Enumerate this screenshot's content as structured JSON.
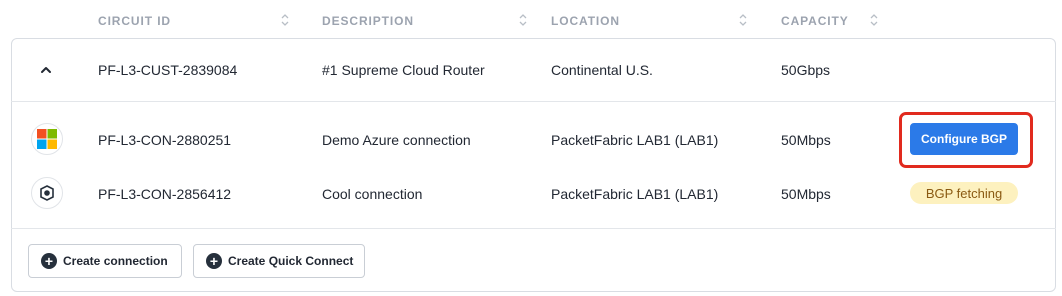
{
  "columns": {
    "circuit_id": "CIRCUIT ID",
    "description": "DESCRIPTION",
    "location": "LOCATION",
    "capacity": "CAPACITY"
  },
  "parent_row": {
    "circuit_id": "PF-L3-CUST-2839084",
    "description": "#1 Supreme Cloud Router",
    "location": "Continental U.S.",
    "capacity": "50Gbps",
    "expanded": true
  },
  "connections": [
    {
      "logo": "microsoft-icon",
      "circuit_id": "PF-L3-CON-2880251",
      "description": "Demo Azure connection",
      "location": "PacketFabric LAB1 (LAB1)",
      "capacity": "50Mbps",
      "action_label": "Configure BGP"
    },
    {
      "logo": "packetfabric-icon",
      "circuit_id": "PF-L3-CON-2856412",
      "description": "Cool connection",
      "location": "PacketFabric LAB1 (LAB1)",
      "capacity": "50Mbps",
      "status_label": "BGP fetching"
    }
  ],
  "footer": {
    "create_connection": "Create connection",
    "create_quick_connect": "Create Quick Connect"
  },
  "colors": {
    "primary": "#2b7ae8",
    "highlight": "#e12a1e",
    "badge_bg": "#fdf1bf",
    "badge_text": "#8a5a12"
  }
}
